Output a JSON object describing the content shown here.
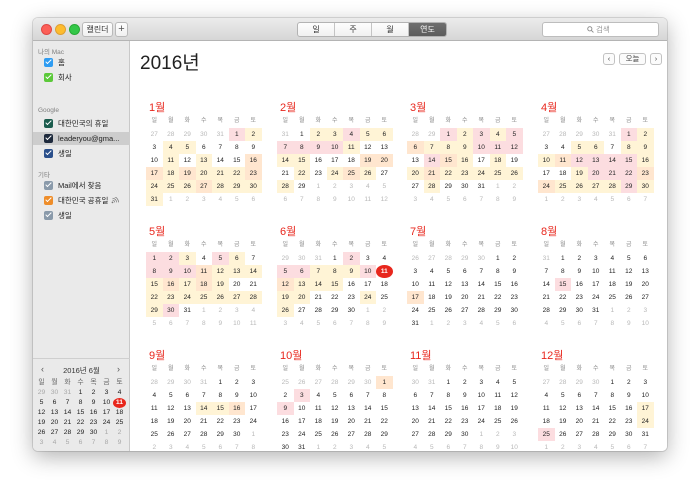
{
  "toolbar": {
    "calendars_label": "캘린더",
    "add_label": "+",
    "views": [
      "일",
      "주",
      "월",
      "연도"
    ],
    "active_view": 3,
    "search_placeholder": "검색"
  },
  "sidebar": {
    "sections": [
      {
        "title": "나의 Mac",
        "items": [
          {
            "label": "홈",
            "color": "#2e9cf2",
            "selected": false
          },
          {
            "label": "회사",
            "color": "#5cc93a",
            "selected": false
          }
        ]
      },
      {
        "title": "Google",
        "items": [
          {
            "label": "대한민국의 휴일",
            "color": "#1b5c4d",
            "selected": false
          },
          {
            "label": "leaderyou@gma...",
            "color": "#1e2a3c",
            "selected": true
          },
          {
            "label": "생일",
            "color": "#2a4f8b",
            "selected": false
          }
        ]
      },
      {
        "title": "기타",
        "items": [
          {
            "label": "Mail에서 찾음",
            "color": "#8a9aaa",
            "selected": false
          },
          {
            "label": "대한민국 공휴일",
            "color": "#ee8d2a",
            "selected": false,
            "broadcast": true
          },
          {
            "label": "생일",
            "color": "#8a9aaa",
            "selected": false
          }
        ]
      }
    ],
    "mini_calendar": {
      "title": "2016년 6월",
      "weekdays": [
        "일",
        "월",
        "화",
        "수",
        "목",
        "금",
        "토"
      ],
      "weeks": [
        [
          "29",
          "30",
          "31",
          "1",
          "2",
          "3",
          "4"
        ],
        [
          "5",
          "6",
          "7",
          "8",
          "9",
          "10",
          "11"
        ],
        [
          "12",
          "13",
          "14",
          "15",
          "16",
          "17",
          "18"
        ],
        [
          "19",
          "20",
          "21",
          "22",
          "23",
          "24",
          "25"
        ],
        [
          "26",
          "27",
          "28",
          "29",
          "30",
          "1",
          "2"
        ],
        [
          "3",
          "4",
          "5",
          "6",
          "7",
          "8",
          "9"
        ]
      ],
      "today": "11"
    }
  },
  "main": {
    "year_title": "2016년",
    "prev_label": "‹",
    "today_label": "오늘",
    "next_label": "›",
    "weekdays": [
      "일",
      "월",
      "화",
      "수",
      "목",
      "금",
      "토"
    ],
    "months": [
      {
        "name": "1월",
        "weeks": [
          [
            "27",
            "28",
            "29",
            "30",
            "31",
            "1",
            "2"
          ],
          [
            "3",
            "4",
            "5",
            "6",
            "7",
            "8",
            "9"
          ],
          [
            "10",
            "11",
            "12",
            "13",
            "14",
            "15",
            "16"
          ],
          [
            "17",
            "18",
            "19",
            "20",
            "21",
            "22",
            "23"
          ],
          [
            "24",
            "25",
            "26",
            "27",
            "28",
            "29",
            "30"
          ],
          [
            "31",
            "1",
            "2",
            "3",
            "4",
            "5",
            "6"
          ]
        ]
      },
      {
        "name": "2월",
        "weeks": [
          [
            "31",
            "1",
            "2",
            "3",
            "4",
            "5",
            "6"
          ],
          [
            "7",
            "8",
            "9",
            "10",
            "11",
            "12",
            "13"
          ],
          [
            "14",
            "15",
            "16",
            "17",
            "18",
            "19",
            "20"
          ],
          [
            "21",
            "22",
            "23",
            "24",
            "25",
            "26",
            "27"
          ],
          [
            "28",
            "29",
            "1",
            "2",
            "3",
            "4",
            "5"
          ],
          [
            "6",
            "7",
            "8",
            "9",
            "10",
            "11",
            "12"
          ]
        ]
      },
      {
        "name": "3월",
        "weeks": [
          [
            "28",
            "29",
            "1",
            "2",
            "3",
            "4",
            "5"
          ],
          [
            "6",
            "7",
            "8",
            "9",
            "10",
            "11",
            "12"
          ],
          [
            "13",
            "14",
            "15",
            "16",
            "17",
            "18",
            "19"
          ],
          [
            "20",
            "21",
            "22",
            "23",
            "24",
            "25",
            "26"
          ],
          [
            "27",
            "28",
            "29",
            "30",
            "31",
            "1",
            "2"
          ],
          [
            "3",
            "4",
            "5",
            "6",
            "7",
            "8",
            "9"
          ]
        ]
      },
      {
        "name": "4월",
        "weeks": [
          [
            "27",
            "28",
            "29",
            "30",
            "31",
            "1",
            "2"
          ],
          [
            "3",
            "4",
            "5",
            "6",
            "7",
            "8",
            "9"
          ],
          [
            "10",
            "11",
            "12",
            "13",
            "14",
            "15",
            "16"
          ],
          [
            "17",
            "18",
            "19",
            "20",
            "21",
            "22",
            "23"
          ],
          [
            "24",
            "25",
            "26",
            "27",
            "28",
            "29",
            "30"
          ],
          [
            "1",
            "2",
            "3",
            "4",
            "5",
            "6",
            "7"
          ]
        ]
      },
      {
        "name": "5월",
        "weeks": [
          [
            "1",
            "2",
            "3",
            "4",
            "5",
            "6",
            "7"
          ],
          [
            "8",
            "9",
            "10",
            "11",
            "12",
            "13",
            "14"
          ],
          [
            "15",
            "16",
            "17",
            "18",
            "19",
            "20",
            "21"
          ],
          [
            "22",
            "23",
            "24",
            "25",
            "26",
            "27",
            "28"
          ],
          [
            "29",
            "30",
            "31",
            "1",
            "2",
            "3",
            "4"
          ],
          [
            "5",
            "6",
            "7",
            "8",
            "9",
            "10",
            "11"
          ]
        ]
      },
      {
        "name": "6월",
        "weeks": [
          [
            "29",
            "30",
            "31",
            "1",
            "2",
            "3",
            "4"
          ],
          [
            "5",
            "6",
            "7",
            "8",
            "9",
            "10",
            "11"
          ],
          [
            "12",
            "13",
            "14",
            "15",
            "16",
            "17",
            "18"
          ],
          [
            "19",
            "20",
            "21",
            "22",
            "23",
            "24",
            "25"
          ],
          [
            "26",
            "27",
            "28",
            "29",
            "30",
            "1",
            "2"
          ],
          [
            "3",
            "4",
            "5",
            "6",
            "7",
            "8",
            "9"
          ]
        ]
      },
      {
        "name": "7월",
        "weeks": [
          [
            "26",
            "27",
            "28",
            "29",
            "30",
            "1",
            "2"
          ],
          [
            "3",
            "4",
            "5",
            "6",
            "7",
            "8",
            "9"
          ],
          [
            "10",
            "11",
            "12",
            "13",
            "14",
            "15",
            "16"
          ],
          [
            "17",
            "18",
            "19",
            "20",
            "21",
            "22",
            "23"
          ],
          [
            "24",
            "25",
            "26",
            "27",
            "28",
            "29",
            "30"
          ],
          [
            "31",
            "1",
            "2",
            "3",
            "4",
            "5",
            "6"
          ]
        ]
      },
      {
        "name": "8월",
        "weeks": [
          [
            "31",
            "1",
            "2",
            "3",
            "4",
            "5",
            "6"
          ],
          [
            "7",
            "8",
            "9",
            "10",
            "11",
            "12",
            "13"
          ],
          [
            "14",
            "15",
            "16",
            "17",
            "18",
            "19",
            "20"
          ],
          [
            "21",
            "22",
            "23",
            "24",
            "25",
            "26",
            "27"
          ],
          [
            "28",
            "29",
            "30",
            "31",
            "1",
            "2",
            "3"
          ],
          [
            "4",
            "5",
            "6",
            "7",
            "8",
            "9",
            "10"
          ]
        ]
      },
      {
        "name": "9월",
        "weeks": [
          [
            "28",
            "29",
            "30",
            "31",
            "1",
            "2",
            "3"
          ],
          [
            "4",
            "5",
            "6",
            "7",
            "8",
            "9",
            "10"
          ],
          [
            "11",
            "12",
            "13",
            "14",
            "15",
            "16",
            "17"
          ],
          [
            "18",
            "19",
            "20",
            "21",
            "22",
            "23",
            "24"
          ],
          [
            "25",
            "26",
            "27",
            "28",
            "29",
            "30",
            "1"
          ],
          [
            "2",
            "3",
            "4",
            "5",
            "6",
            "7",
            "8"
          ]
        ]
      },
      {
        "name": "10월",
        "weeks": [
          [
            "25",
            "26",
            "27",
            "28",
            "29",
            "30",
            "1"
          ],
          [
            "2",
            "3",
            "4",
            "5",
            "6",
            "7",
            "8"
          ],
          [
            "9",
            "10",
            "11",
            "12",
            "13",
            "14",
            "15"
          ],
          [
            "16",
            "17",
            "18",
            "19",
            "20",
            "21",
            "22"
          ],
          [
            "23",
            "24",
            "25",
            "26",
            "27",
            "28",
            "29"
          ],
          [
            "30",
            "31",
            "1",
            "2",
            "3",
            "4",
            "5"
          ]
        ]
      },
      {
        "name": "11월",
        "weeks": [
          [
            "30",
            "31",
            "1",
            "2",
            "3",
            "4",
            "5"
          ],
          [
            "6",
            "7",
            "8",
            "9",
            "10",
            "11",
            "12"
          ],
          [
            "13",
            "14",
            "15",
            "16",
            "17",
            "18",
            "19"
          ],
          [
            "20",
            "21",
            "22",
            "23",
            "24",
            "25",
            "26"
          ],
          [
            "27",
            "28",
            "29",
            "30",
            "1",
            "2",
            "3"
          ],
          [
            "4",
            "5",
            "6",
            "7",
            "8",
            "9",
            "10"
          ]
        ]
      },
      {
        "name": "12월",
        "weeks": [
          [
            "27",
            "28",
            "29",
            "30",
            "1",
            "2",
            "3"
          ],
          [
            "4",
            "5",
            "6",
            "7",
            "8",
            "9",
            "10"
          ],
          [
            "11",
            "12",
            "13",
            "14",
            "15",
            "16",
            "17"
          ],
          [
            "18",
            "19",
            "20",
            "21",
            "22",
            "23",
            "24"
          ],
          [
            "25",
            "26",
            "27",
            "28",
            "29",
            "30",
            "31"
          ],
          [
            "1",
            "2",
            "3",
            "4",
            "5",
            "6",
            "7"
          ]
        ]
      }
    ],
    "today": {
      "month": 6,
      "day": "11"
    },
    "highlights": {
      "1": {
        "1": 3,
        "2": 1,
        "4": 1,
        "5": 1,
        "11": 1,
        "13": 1,
        "16": 2,
        "17": 2,
        "18": 1,
        "19": 2,
        "20": 1,
        "21": 1,
        "22": 1,
        "23": 2,
        "24": 1,
        "25": 1,
        "26": 1,
        "27": 2,
        "28": 1,
        "29": 1,
        "30": 1,
        "31": 1
      },
      "2": {
        "2": 1,
        "3": 1,
        "4": 3,
        "5": 1,
        "6": 1,
        "7": 3,
        "8": 3,
        "9": 3,
        "10": 3,
        "11": 1,
        "14": 1,
        "15": 1,
        "19": 2,
        "20": 2,
        "22": 1,
        "24": 1,
        "25": 2,
        "26": 1,
        "28": 1
      },
      "3": {
        "1": 3,
        "2": 1,
        "3": 3,
        "4": 1,
        "5": 3,
        "6": 2,
        "7": 1,
        "8": 1,
        "9": 1,
        "10": 3,
        "11": 3,
        "12": 3,
        "14": 3,
        "15": 2,
        "16": 1,
        "18": 1,
        "20": 1,
        "21": 2,
        "22": 1,
        "23": 1,
        "24": 1,
        "25": 1,
        "26": 1,
        "28": 1
      },
      "4": {
        "1": 3,
        "2": 1,
        "5": 1,
        "6": 1,
        "8": 1,
        "9": 1,
        "10": 1,
        "11": 2,
        "12": 3,
        "13": 3,
        "14": 3,
        "15": 3,
        "16": 1,
        "19": 1,
        "20": 3,
        "21": 3,
        "22": 3,
        "23": 2,
        "24": 2,
        "25": 1,
        "26": 1,
        "27": 1,
        "28": 1,
        "29": 3,
        "30": 1
      },
      "5": {
        "1": 3,
        "2": 3,
        "3": 1,
        "5": 3,
        "6": 1,
        "8": 3,
        "9": 3,
        "10": 3,
        "11": 2,
        "12": 1,
        "13": 1,
        "14": 1,
        "15": 1,
        "16": 2,
        "17": 1,
        "18": 2,
        "19": 1,
        "22": 1,
        "23": 1,
        "24": 1,
        "25": 1,
        "26": 1,
        "27": 1,
        "28": 1,
        "29": 1,
        "30": 3
      },
      "6": {
        "2": 3,
        "5": 3,
        "6": 3,
        "7": 1,
        "8": 1,
        "9": 1,
        "10": 3,
        "12": 2,
        "13": 1,
        "14": 1,
        "15": 1,
        "19": 1,
        "20": 1,
        "24": 1,
        "26": 1
      },
      "7": {
        "17": 2
      },
      "8": {
        "15": 3
      },
      "9": {
        "14": 1,
        "15": 1,
        "16": 2
      },
      "10": {
        "1": 2,
        "3": 3,
        "9": 3
      },
      "11": {},
      "12": {
        "17": 1,
        "24": 1,
        "25": 3
      }
    }
  }
}
